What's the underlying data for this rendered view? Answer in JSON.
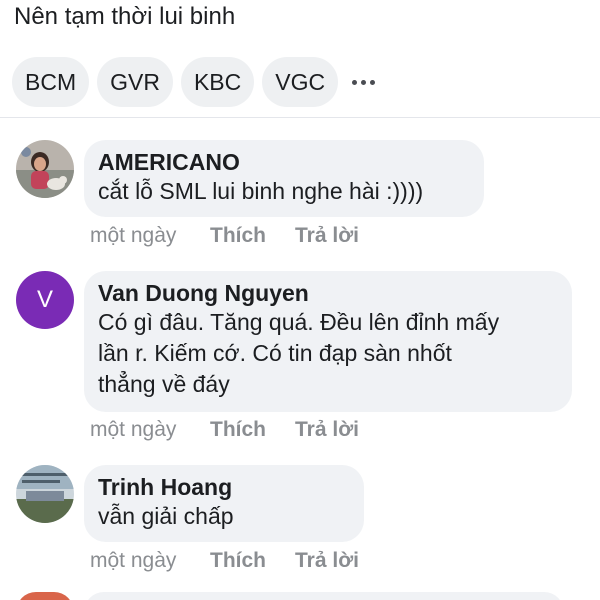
{
  "post": {
    "text": "Nên tạm thời lui binh"
  },
  "tags": [
    "BCM",
    "GVR",
    "KBC",
    "VGC"
  ],
  "more_icon": "more-horizontal-icon",
  "comments": [
    {
      "author": "AMERICANO",
      "text": "cắt lỗ SML lui binh nghe hài :))))",
      "time": "một ngày",
      "like": "Thích",
      "reply": "Trả lời"
    },
    {
      "avatar_letter": "V",
      "avatar_color": "#7a2bb5",
      "author": "Van Duong Nguyen",
      "text": "Có gì đâu. Tăng quá. Đều lên đỉnh mấy\nlần r. Kiếm cớ. Có tin đạp sàn nhốt\nthẳng về đáy",
      "time": "một ngày",
      "like": "Thích",
      "reply": "Trả lời"
    },
    {
      "author": "Trinh Hoang",
      "text": "vẫn giải chấp",
      "time": "một ngày",
      "like": "Thích",
      "reply": "Trả lời"
    }
  ],
  "colors": {
    "bubble_bg": "#f0f2f5",
    "chip_bg": "#eef0f2",
    "meta_text": "#8a8d91"
  }
}
